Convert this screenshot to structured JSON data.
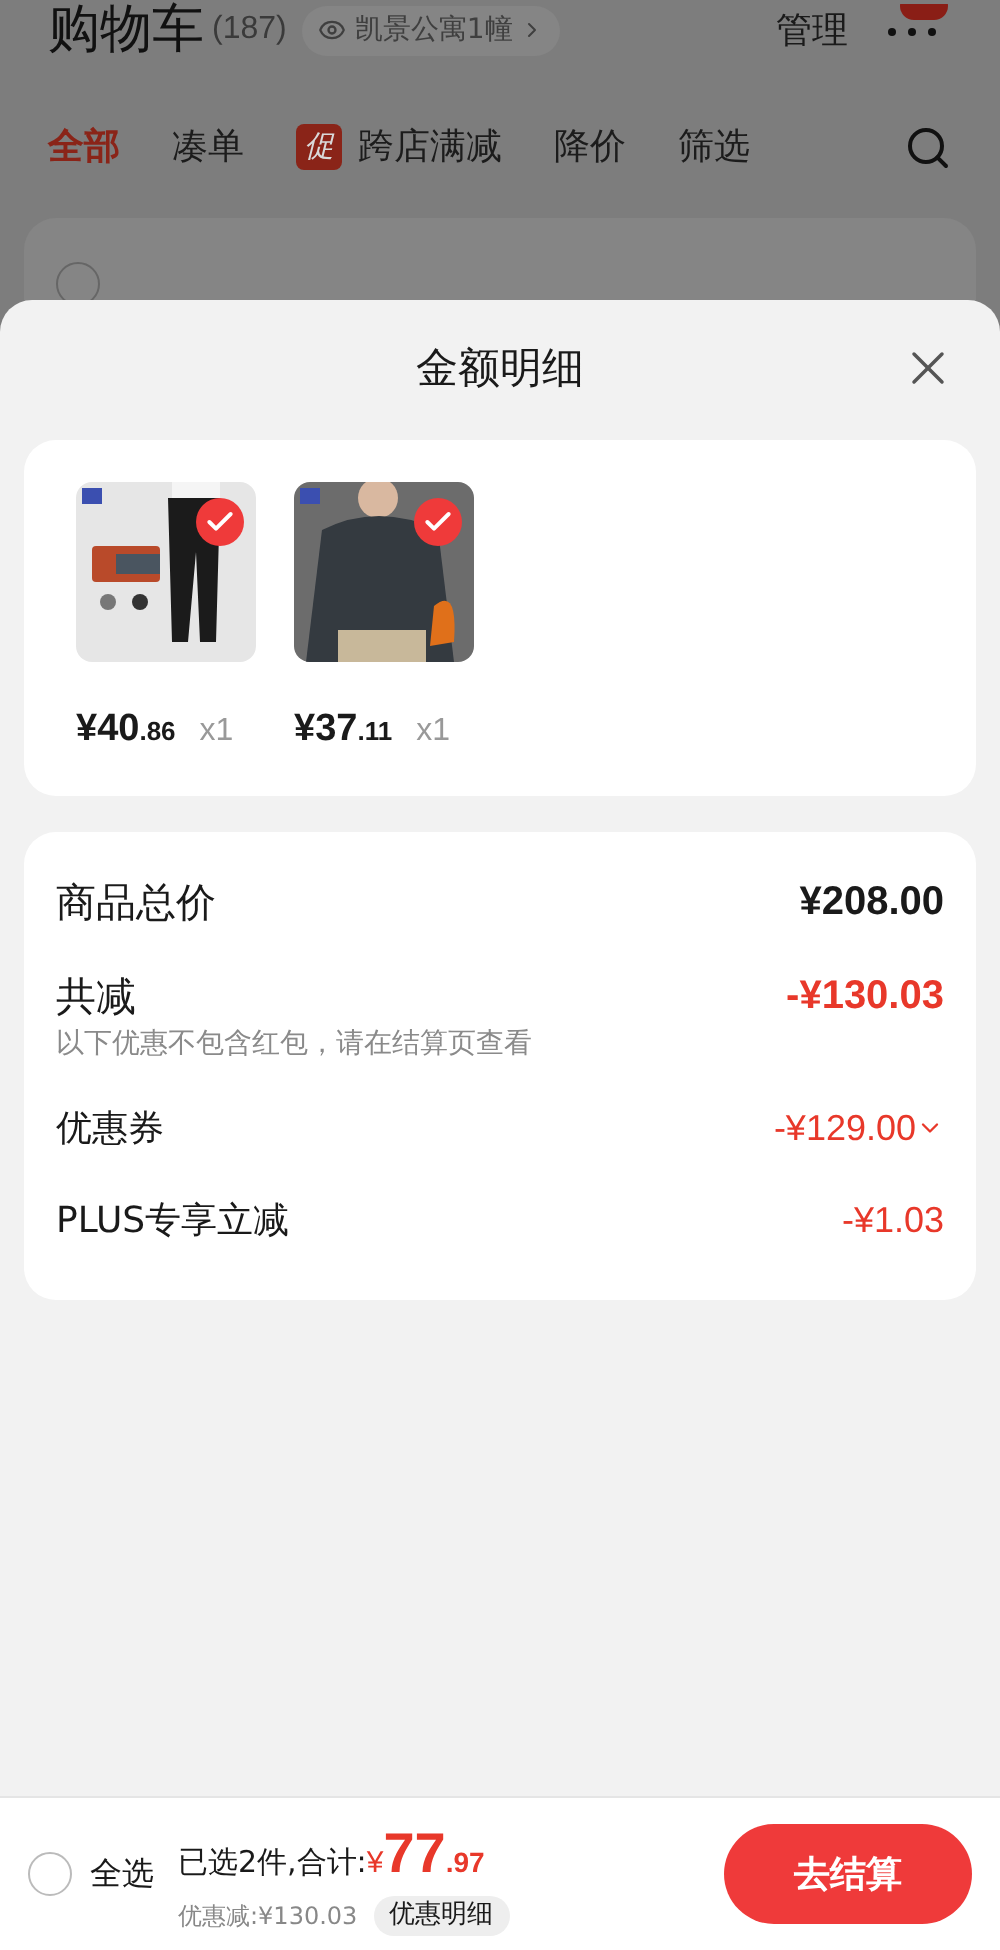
{
  "header": {
    "title": "购物车",
    "count": "(187)",
    "address": "凯景公寓1幢",
    "manage": "管理"
  },
  "tabs": [
    {
      "label": "全部",
      "selected": true
    },
    {
      "label": "凑单",
      "selected": false
    },
    {
      "label": "跨店满减",
      "badge": "促",
      "selected": false
    },
    {
      "label": "降价",
      "selected": false
    },
    {
      "label": "筛选",
      "selected": false
    }
  ],
  "store": {
    "checked": false
  },
  "sheet": {
    "title": "金额明细",
    "products": [
      {
        "price_main": "¥40",
        "price_cents": ".86",
        "quantity": "x1",
        "checked": true
      },
      {
        "price_main": "¥37",
        "price_cents": ".11",
        "quantity": "x1",
        "checked": true
      }
    ],
    "summary": [
      {
        "kind": "total",
        "label": "商品总价",
        "value": "¥208.00"
      },
      {
        "kind": "discount",
        "label": "共减",
        "value": "-¥130.03",
        "note": "以下优惠不包含红包，请在结算页查看"
      },
      {
        "kind": "item",
        "label": "优惠券",
        "value": "-¥129.00",
        "expandable": true
      },
      {
        "kind": "item",
        "label": "PLUS专享立减",
        "value": "-¥1.03",
        "expandable": false
      }
    ]
  },
  "footer": {
    "select_all": {
      "label": "全选",
      "checked": false
    },
    "selected_text": "已选2件,合计:",
    "currency": "¥",
    "total_main": "77",
    "total_cents": ".97",
    "discount_text": "优惠减:¥130.03",
    "detail_button": "优惠明细",
    "checkout_button": "去结算"
  }
}
